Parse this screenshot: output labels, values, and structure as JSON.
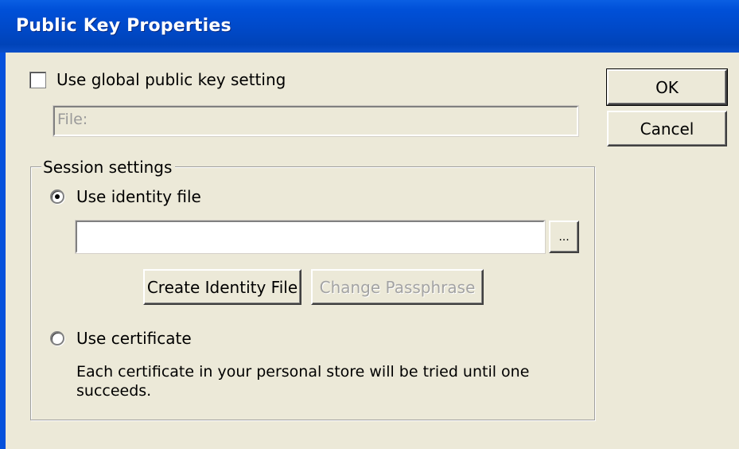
{
  "window": {
    "title": "Public Key Properties"
  },
  "global_setting": {
    "checkbox_label": "Use global public key setting",
    "checked": false,
    "file_placeholder": "File:",
    "file_value": ""
  },
  "buttons": {
    "ok": "OK",
    "cancel": "Cancel"
  },
  "session": {
    "group_label": "Session settings",
    "identity_radio_label": "Use identity file",
    "identity_selected": true,
    "identity_file_value": "",
    "browse_label": "...",
    "create_identity_label": "Create Identity File",
    "change_passphrase_label": "Change Passphrase",
    "certificate_radio_label": "Use certificate",
    "certificate_note_line1": "Each certificate in your personal store will be tried until one",
    "certificate_note_line2": "succeeds."
  },
  "colors": {
    "titlebar": "#0050d8",
    "face": "#ece9d8",
    "disabled_text": "#a3a3a3"
  }
}
